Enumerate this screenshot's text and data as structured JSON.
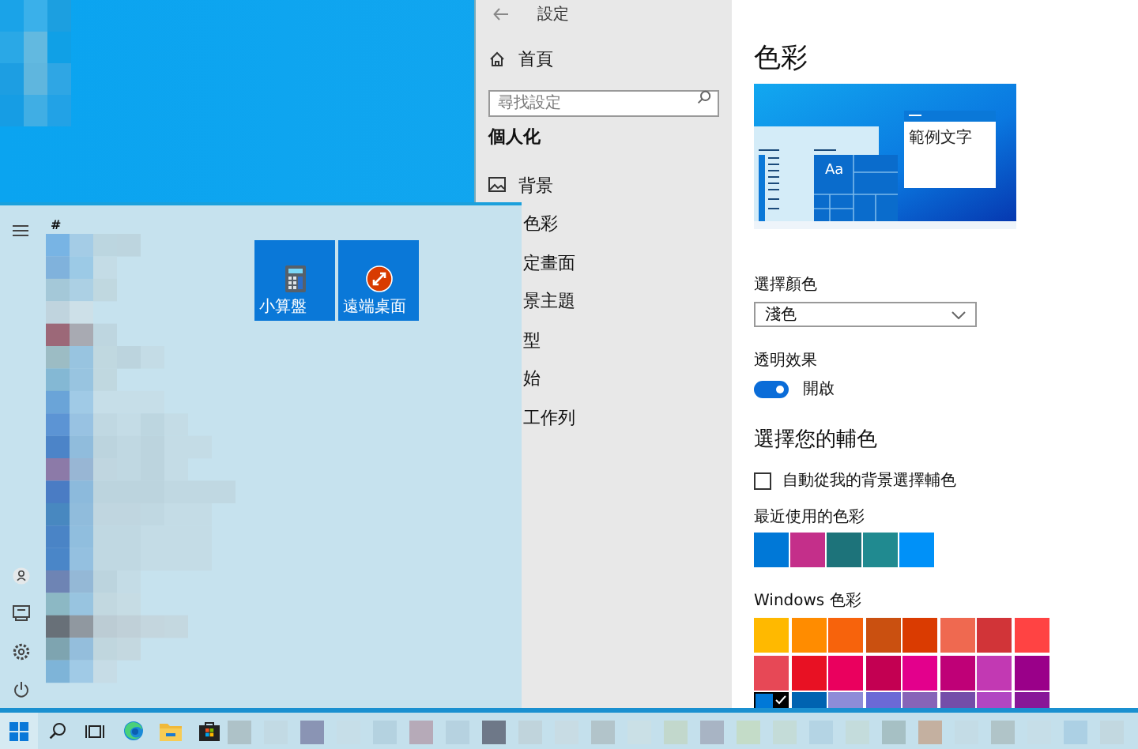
{
  "settings_window": {
    "title": "設定",
    "nav": {
      "home": "首頁",
      "search": {
        "placeholder": "尋找設定"
      },
      "section": "個人化",
      "items": [
        {
          "label": "背景",
          "kind": "icon"
        },
        {
          "label": "色彩",
          "kind": "covered"
        },
        {
          "label": "定畫面",
          "kind": "covered"
        },
        {
          "label": "景主題",
          "kind": "covered"
        },
        {
          "label": "型",
          "kind": "covered"
        },
        {
          "label": "始",
          "kind": "covered"
        },
        {
          "label": "工作列",
          "kind": "covered"
        }
      ]
    },
    "content": {
      "title": "色彩",
      "preview": {
        "tile_text": "Aa",
        "sample_text": "範例文字"
      },
      "color_mode": {
        "label": "選擇顏色",
        "value": "淺色"
      },
      "transparency": {
        "label": "透明效果",
        "on": true,
        "state_text": "開啟"
      },
      "accent_heading": "選擇您的輔色",
      "auto_accent": {
        "label": "自動從我的背景選擇輔色",
        "checked": false
      },
      "recent": {
        "label": "最近使用的色彩",
        "swatches": [
          {
            "color": "#0078d7",
            "selected": false
          },
          {
            "color": "#c42f8a",
            "selected": false
          },
          {
            "color": "#1d737a",
            "selected": false
          },
          {
            "color": "#208a90",
            "selected": false
          },
          {
            "color": "#0091f8",
            "selected": false
          }
        ]
      },
      "windows_colors": {
        "label": "Windows 色彩",
        "swatches": [
          {
            "color": "#ffb900",
            "selected": false
          },
          {
            "color": "#ff8c00",
            "selected": false
          },
          {
            "color": "#f7630c",
            "selected": false
          },
          {
            "color": "#ca5010",
            "selected": false
          },
          {
            "color": "#da3b01",
            "selected": false
          },
          {
            "color": "#ef6950",
            "selected": false
          },
          {
            "color": "#d13438",
            "selected": false
          },
          {
            "color": "#ff4343",
            "selected": false
          },
          {
            "color": "#e74856",
            "selected": false
          },
          {
            "color": "#e81123",
            "selected": false
          },
          {
            "color": "#ea005e",
            "selected": false
          },
          {
            "color": "#c30052",
            "selected": false
          },
          {
            "color": "#e3008c",
            "selected": false
          },
          {
            "color": "#bf0077",
            "selected": false
          },
          {
            "color": "#c239b3",
            "selected": false
          },
          {
            "color": "#9a0089",
            "selected": false
          },
          {
            "color": "#0078d7",
            "selected": true
          },
          {
            "color": "#0063b1",
            "selected": false
          },
          {
            "color": "#8e8cd8",
            "selected": false
          },
          {
            "color": "#6b69d6",
            "selected": false
          },
          {
            "color": "#8764b8",
            "selected": false
          },
          {
            "color": "#744da9",
            "selected": false
          },
          {
            "color": "#b146c2",
            "selected": false
          },
          {
            "color": "#881798",
            "selected": false
          }
        ]
      }
    }
  },
  "start_menu": {
    "letter": "#",
    "tiles": [
      {
        "label": "小算盤",
        "kind": "calculator"
      },
      {
        "label": "遠端桌面",
        "kind": "remote"
      }
    ]
  }
}
